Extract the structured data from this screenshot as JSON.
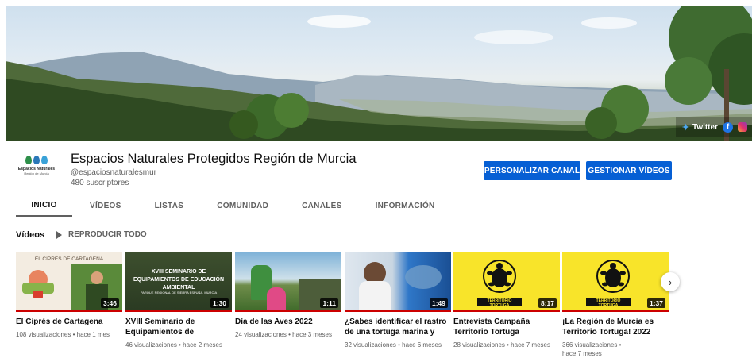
{
  "banner": {
    "social": {
      "twitter_label": "Twitter"
    }
  },
  "channel": {
    "logo_line1": "Espacios Naturales",
    "logo_line2": "Región de Murcia",
    "name": "Espacios Naturales Protegidos Región de Murcia",
    "handle": "@espaciosnaturalesmur",
    "subscribers": "480 suscriptores",
    "customize_label": "PERSONALIZAR CANAL",
    "manage_label": "GESTIONAR VÍDEOS"
  },
  "tabs": [
    {
      "label": "INICIO",
      "active": true
    },
    {
      "label": "VÍDEOS"
    },
    {
      "label": "LISTAS"
    },
    {
      "label": "COMUNIDAD"
    },
    {
      "label": "CANALES"
    },
    {
      "label": "INFORMACIÓN"
    }
  ],
  "section": {
    "title": "Vídeos",
    "play_all": "REPRODUCIR TODO"
  },
  "videos": [
    {
      "title": "El Ciprés de Cartagena",
      "meta": "108 visualizaciones • hace 1 mes",
      "duration": "3:46",
      "thumb_text": "EL CIPRÉS DE CARTAGENA"
    },
    {
      "title": "XVIII Seminario de Equipamientos de Educació...",
      "meta": "46 visualizaciones • hace 2 meses",
      "duration": "1:30",
      "thumb_text": "XVIII SEMINARIO DE EQUIPAMIENTOS DE EDUCACIÓN AMBIENTAL",
      "thumb_sub": "PARQUE REGIONAL DE SIERRA ESPUÑA, MURCIA"
    },
    {
      "title": "Día de las Aves 2022",
      "meta": "24 visualizaciones • hace 3 meses",
      "duration": "1:11"
    },
    {
      "title": "¿Sabes identificar el rastro de una tortuga marina y cómo...",
      "meta": "32 visualizaciones • hace 6 meses",
      "duration": "1:49"
    },
    {
      "title": "Entrevista Campaña Territorio Tortuga",
      "meta": "28 visualizaciones • hace 7 meses",
      "duration": "8:17",
      "thumb_text": "TERRITORIO TORTUGA"
    },
    {
      "title": "¡La Región de Murcia es Territorio Tortuga! 2022",
      "meta": "366 visualizaciones • hace 7 meses",
      "duration": "1:37",
      "thumb_text": "TERRITORIO TORTUGA"
    }
  ],
  "icons": {
    "next": "chevron-right-icon",
    "twitter": "twitter-icon",
    "facebook": "facebook-icon",
    "instagram": "instagram-icon"
  },
  "colors": {
    "primary_button": "#065fd4",
    "progress_red": "#cc0000",
    "turtle_yellow": "#f8e42a"
  }
}
